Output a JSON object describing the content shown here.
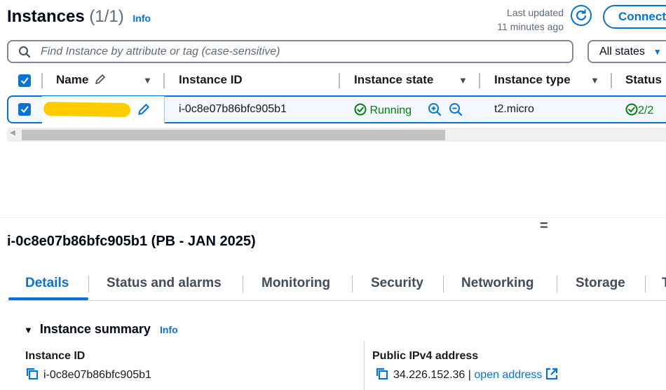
{
  "header": {
    "title": "Instances",
    "count": "(1/1)",
    "info": "Info",
    "updated_line1": "Last updated",
    "updated_line2": "11 minutes ago",
    "connect_label": "Connect"
  },
  "search": {
    "placeholder": "Find Instance by attribute or tag (case-sensitive)",
    "state_filter": "All states"
  },
  "table": {
    "columns": [
      "Name",
      "Instance ID",
      "Instance state",
      "Instance type",
      "Status"
    ],
    "row": {
      "instance_id": "i-0c8e07b86bfc905b1",
      "state": "Running",
      "type": "t2.micro",
      "status": "2/2"
    }
  },
  "detail": {
    "title": "i-0c8e07b86bfc905b1 (PB - JAN 2025)",
    "tabs": [
      "Details",
      "Status and alarms",
      "Monitoring",
      "Security",
      "Networking",
      "Storage",
      "T"
    ],
    "summary_title": "Instance summary",
    "summary_info": "Info",
    "fields": {
      "instance_id_label": "Instance ID",
      "instance_id_value": "i-0c8e07b86bfc905b1",
      "public_ip_label": "Public IPv4 address",
      "public_ip_value": "34.226.152.36",
      "public_ip_sep": "|",
      "open_address": "open address"
    }
  },
  "colors": {
    "accent": "#0972d3",
    "success": "#037f0c",
    "redaction": "#ffcc00"
  }
}
